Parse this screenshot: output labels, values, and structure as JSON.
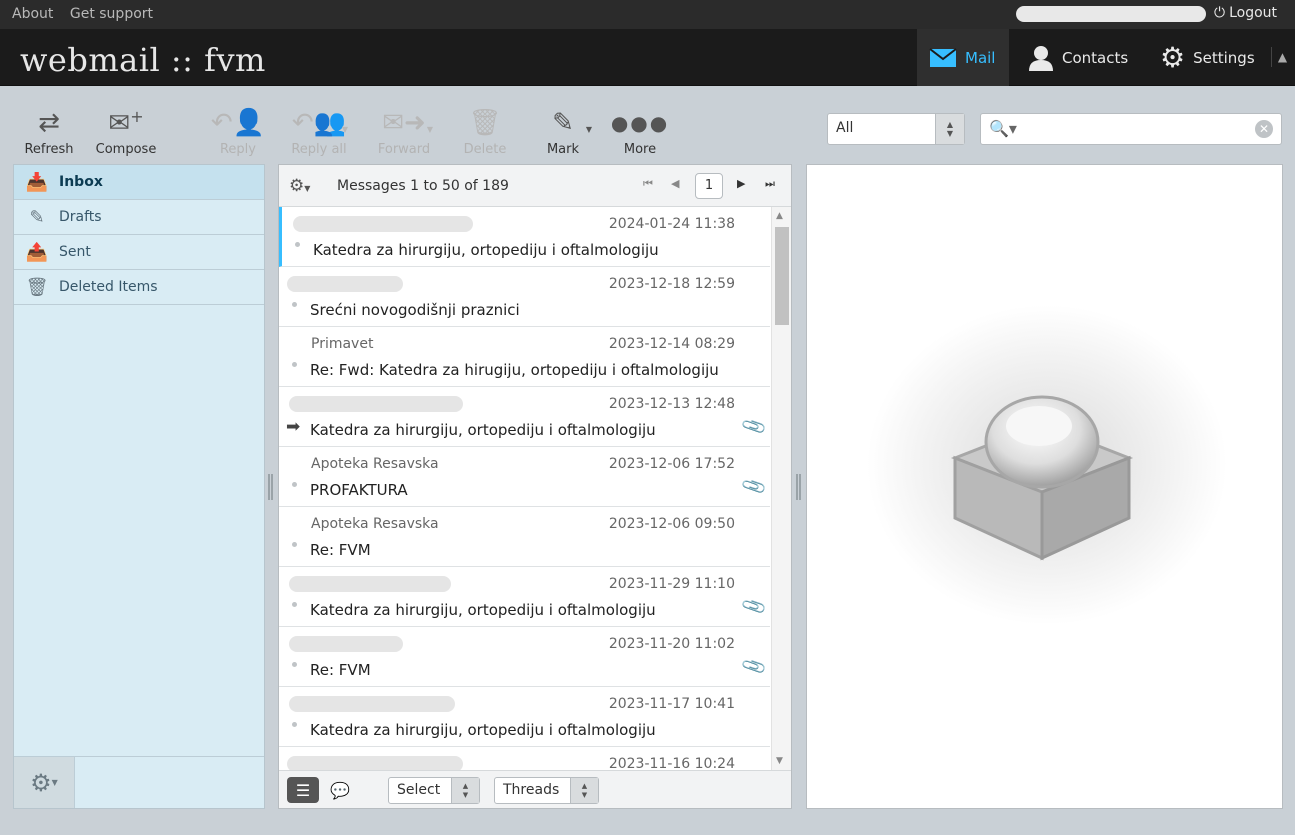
{
  "topline": {
    "links": [
      "About",
      "Get support"
    ],
    "logout": "Logout"
  },
  "header": {
    "logo": "webmail :: fvm",
    "tasks": [
      {
        "label": "Mail",
        "icon": "envelope-icon",
        "selected": true
      },
      {
        "label": "Contacts",
        "icon": "person-icon",
        "selected": false
      },
      {
        "label": "Settings",
        "icon": "gear-icon",
        "selected": false
      }
    ]
  },
  "toolbar": {
    "refresh": "Refresh",
    "compose": "Compose",
    "reply": "Reply",
    "reply_all": "Reply all",
    "forward": "Forward",
    "delete": "Delete",
    "mark": "Mark",
    "more": "More"
  },
  "filter": {
    "value": "All"
  },
  "search": {
    "placeholder": ""
  },
  "folders": [
    {
      "label": "Inbox",
      "icon": "inbox-icon",
      "selected": true
    },
    {
      "label": "Drafts",
      "icon": "pencil-icon",
      "selected": false
    },
    {
      "label": "Sent",
      "icon": "sent-icon",
      "selected": false
    },
    {
      "label": "Deleted Items",
      "icon": "trash-icon",
      "selected": false
    }
  ],
  "list": {
    "count": "Messages 1 to 50 of 189",
    "page": "1",
    "footer": {
      "select": "Select",
      "threads": "Threads"
    }
  },
  "messages": [
    {
      "from": "",
      "date": "2024-01-24 11:38",
      "subject": "Katedra za hirurgiju, ortopediju i oftalmologiju",
      "attachment": false,
      "status": "dot"
    },
    {
      "from": "",
      "date": "2023-12-18 12:59",
      "subject": "Srećni novogodišnji praznici",
      "attachment": false,
      "status": "dot"
    },
    {
      "from": "Primavet",
      "date": "2023-12-14 08:29",
      "subject": "Re: Fwd: Katedra za hirugiju, ortopediju i oftalmologiju",
      "attachment": false,
      "status": "dot"
    },
    {
      "from": "",
      "date": "2023-12-13 12:48",
      "subject": "Katedra za hirurgiju, ortopediju i oftalmologiju",
      "attachment": true,
      "status": "forwarded"
    },
    {
      "from": "Apoteka Resavska",
      "date": "2023-12-06 17:52",
      "subject": "PROFAKTURA",
      "attachment": true,
      "status": "dot"
    },
    {
      "from": "Apoteka Resavska",
      "date": "2023-12-06 09:50",
      "subject": "Re: FVM",
      "attachment": false,
      "status": "dot"
    },
    {
      "from": "",
      "date": "2023-11-29 11:10",
      "subject": "Katedra za hirurgiju, ortopediju i oftalmologiju",
      "attachment": true,
      "status": "dot"
    },
    {
      "from": "",
      "date": "2023-11-20 11:02",
      "subject": "Re: FVM",
      "attachment": true,
      "status": "dot"
    },
    {
      "from": "",
      "date": "2023-11-17 10:41",
      "subject": "Katedra za hirurgiju, ortopediju i oftalmologiju",
      "attachment": false,
      "status": "dot"
    },
    {
      "from": "",
      "date": "2023-11-16 10:24",
      "subject": "",
      "attachment": false,
      "status": "dot"
    }
  ],
  "colors": {
    "accent": "#37beff",
    "folder_bg": "#d9ecf4",
    "header_bg": "#1b1b1b"
  }
}
